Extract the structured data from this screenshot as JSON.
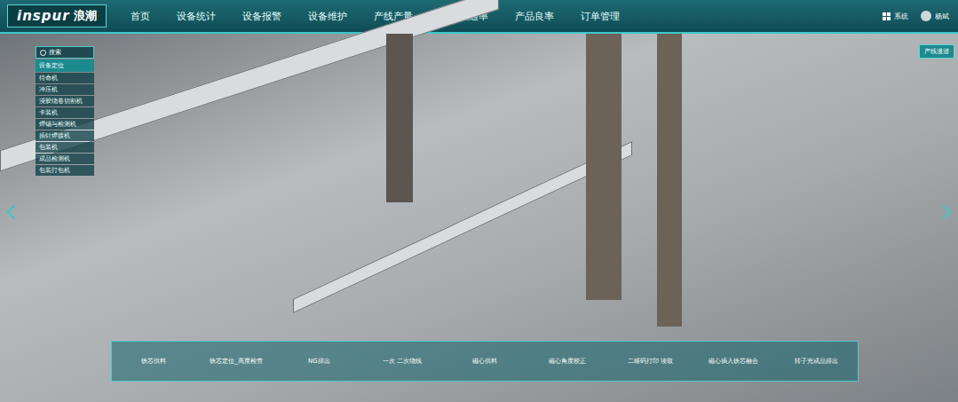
{
  "header": {
    "logo": "inspur",
    "logo_cn": "浪潮",
    "nav": [
      {
        "label": "首页",
        "selected": false
      },
      {
        "label": "设备统计",
        "selected": false
      },
      {
        "label": "设备报警",
        "selected": false
      },
      {
        "label": "设备维护",
        "selected": false
      },
      {
        "label": "产线产量",
        "selected": false
      },
      {
        "label": "产品直通率",
        "selected": false
      },
      {
        "label": "产品良率",
        "selected": false
      },
      {
        "label": "订单管理",
        "selected": false
      }
    ],
    "system": "系统",
    "user": "杨斌"
  },
  "sidebar": {
    "search": "搜索",
    "title": "设备定位",
    "items": [
      "待命机",
      "冲压机",
      "浸胶绕卷切割机",
      "卡装机",
      "焊锡与检测机",
      "插针焊接机",
      "包装机",
      "成品检测机",
      "包装打包机"
    ]
  },
  "roam_button": "产线漫游",
  "process_steps": [
    "铁芯供料",
    "铁芯定位_高度检查",
    "NG排出",
    "一次 二次绕线",
    "磁心供料",
    "磁心角度校正",
    "二维码打印 读取",
    "磁心插入铁芯融合",
    "转子完成品排出"
  ]
}
